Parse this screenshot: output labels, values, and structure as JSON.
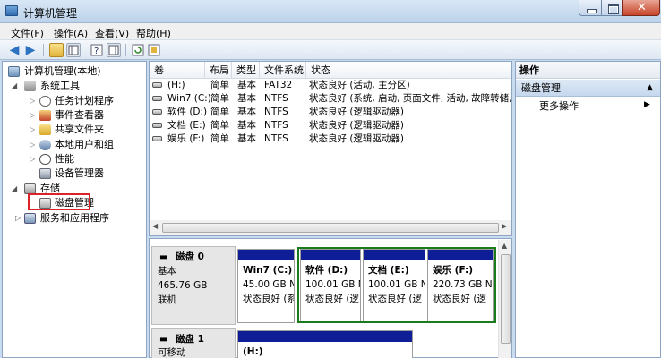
{
  "window": {
    "title": "计算机管理"
  },
  "menu": [
    "文件(F)",
    "操作(A)",
    "查看(V)",
    "帮助(H)"
  ],
  "tree": {
    "root": "计算机管理(本地)",
    "system_tools": "系统工具",
    "task_scheduler": "任务计划程序",
    "event_viewer": "事件查看器",
    "shared_folders": "共享文件夹",
    "local_users": "本地用户和组",
    "performance": "性能",
    "device_manager": "设备管理器",
    "storage": "存储",
    "disk_management": "磁盘管理",
    "services": "服务和应用程序"
  },
  "volume_list": {
    "headers": [
      "卷",
      "布局",
      "类型",
      "文件系统",
      "状态"
    ],
    "rows": [
      [
        "(H:)",
        "简单",
        "基本",
        "FAT32",
        "状态良好 (活动, 主分区)"
      ],
      [
        "Win7 (C:)",
        "简单",
        "基本",
        "NTFS",
        "状态良好 (系统, 启动, 页面文件, 活动, 故障转储, 主分"
      ],
      [
        "软件 (D:)",
        "简单",
        "基本",
        "NTFS",
        "状态良好 (逻辑驱动器)"
      ],
      [
        "文档 (E:)",
        "简单",
        "基本",
        "NTFS",
        "状态良好 (逻辑驱动器)"
      ],
      [
        "娱乐 (F:)",
        "简单",
        "基本",
        "NTFS",
        "状态良好 (逻辑驱动器)"
      ]
    ]
  },
  "disk0": {
    "name": "磁盘 0",
    "type": "基本",
    "size": "465.76 GB",
    "status": "联机",
    "partitions": [
      {
        "name": "Win7  (C:)",
        "size": "45.00 GB N",
        "status": "状态良好 (系"
      },
      {
        "name": "软件  (D:)",
        "size": "100.01 GB N",
        "status": "状态良好 (逻"
      },
      {
        "name": "文档  (E:)",
        "size": "100.01 GB N",
        "status": "状态良好 (逻"
      },
      {
        "name": "娱乐  (F:)",
        "size": "220.73 GB N",
        "status": "状态良好 (逻"
      }
    ]
  },
  "disk1": {
    "name": "磁盘 1",
    "type": "可移动",
    "partitions": [
      {
        "name": "(H:)"
      }
    ]
  },
  "actions": {
    "header": "操作",
    "section": "磁盘管理",
    "more": "更多操作"
  },
  "colors": {
    "partition_bar": "#0f1e96",
    "highlight_red": "#d8232a",
    "highlight_green": "#1b7a1b"
  }
}
